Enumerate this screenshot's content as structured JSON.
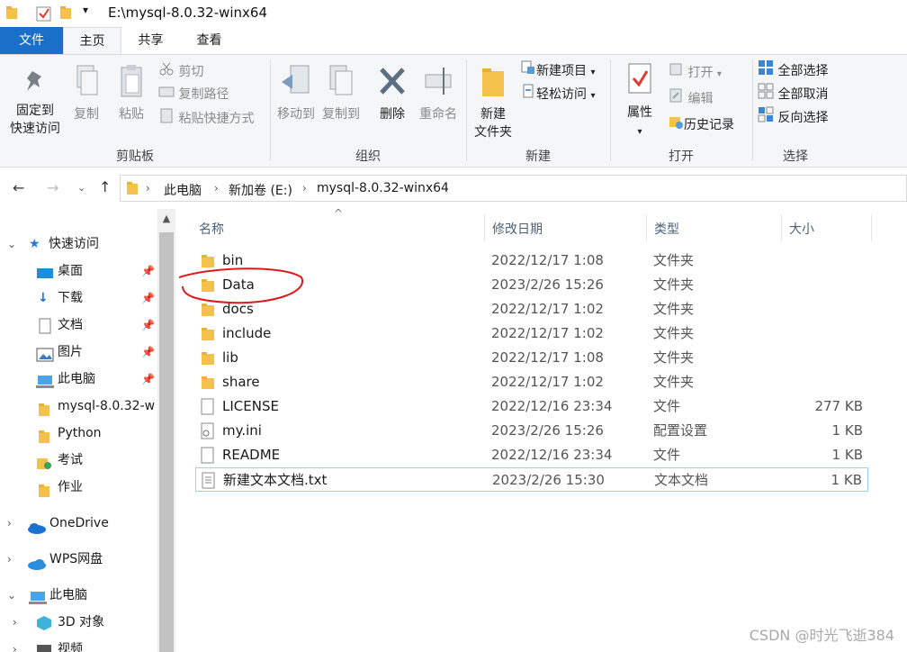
{
  "window": {
    "path": "E:\\mysql-8.0.32-winx64"
  },
  "ribbon_tabs": [
    {
      "label": "文件"
    },
    {
      "label": "主页"
    },
    {
      "label": "共享"
    },
    {
      "label": "查看"
    }
  ],
  "ribbon": {
    "clipboard": {
      "pin_quick_access": "固定到\n快速访问",
      "pin_line1": "固定到",
      "pin_line2": "快速访问",
      "copy": "复制",
      "paste": "粘贴",
      "cut": "剪切",
      "copy_path": "复制路径",
      "paste_shortcut": "粘贴快捷方式",
      "group_label": "剪贴板"
    },
    "organize": {
      "move_to": "移动到",
      "copy_to": "复制到",
      "delete": "删除",
      "rename": "重命名",
      "group_label": "组织"
    },
    "new": {
      "new_folder_line1": "新建",
      "new_folder_line2": "文件夹",
      "new_item": "新建项目",
      "easy_access": "轻松访问",
      "group_label": "新建"
    },
    "open": {
      "properties": "属性",
      "open": "打开",
      "edit": "编辑",
      "history": "历史记录",
      "group_label": "打开"
    },
    "select": {
      "select_all": "全部选择",
      "select_none": "全部取消",
      "invert": "反向选择",
      "group_label": "选择"
    }
  },
  "address": {
    "crumbs": [
      "此电脑",
      "新加卷 (E:)",
      "mysql-8.0.32-winx64"
    ]
  },
  "nav": {
    "quick_access": "快速访问",
    "items": [
      {
        "label": "桌面",
        "pinned": true
      },
      {
        "label": "下载",
        "pinned": true
      },
      {
        "label": "文档",
        "pinned": true
      },
      {
        "label": "图片",
        "pinned": true
      },
      {
        "label": "此电脑",
        "pinned": true
      },
      {
        "label": "mysql-8.0.32-w",
        "pinned": false
      },
      {
        "label": "Python",
        "pinned": false
      },
      {
        "label": "考试",
        "pinned": false
      },
      {
        "label": "作业",
        "pinned": false
      }
    ],
    "onedrive": "OneDrive",
    "wps": "WPS网盘",
    "this_pc": "此电脑",
    "objects_3d": "3D 对象",
    "video": "视频"
  },
  "columns": {
    "name": "名称",
    "date": "修改日期",
    "type": "类型",
    "size": "大小"
  },
  "files": [
    {
      "name": "bin",
      "date": "2022/12/17 1:08",
      "type": "文件夹",
      "size": "",
      "kind": "folder"
    },
    {
      "name": "Data",
      "date": "2023/2/26 15:26",
      "type": "文件夹",
      "size": "",
      "kind": "folder"
    },
    {
      "name": "docs",
      "date": "2022/12/17 1:02",
      "type": "文件夹",
      "size": "",
      "kind": "folder"
    },
    {
      "name": "include",
      "date": "2022/12/17 1:02",
      "type": "文件夹",
      "size": "",
      "kind": "folder"
    },
    {
      "name": "lib",
      "date": "2022/12/17 1:08",
      "type": "文件夹",
      "size": "",
      "kind": "folder"
    },
    {
      "name": "share",
      "date": "2022/12/17 1:02",
      "type": "文件夹",
      "size": "",
      "kind": "folder"
    },
    {
      "name": "LICENSE",
      "date": "2022/12/16 23:34",
      "type": "文件",
      "size": "277 KB",
      "kind": "file"
    },
    {
      "name": "my.ini",
      "date": "2023/2/26 15:26",
      "type": "配置设置",
      "size": "1 KB",
      "kind": "ini"
    },
    {
      "name": "README",
      "date": "2022/12/16 23:34",
      "type": "文件",
      "size": "1 KB",
      "kind": "file"
    },
    {
      "name": "新建文本文档.txt",
      "date": "2023/2/26 15:30",
      "type": "文本文档",
      "size": "1 KB",
      "kind": "txt"
    }
  ],
  "watermark": "CSDN @时光飞逝384",
  "colors": {
    "accent": "#1a6fc9",
    "annotation": "#e01b1b",
    "selection_border": "#99d1ff"
  }
}
